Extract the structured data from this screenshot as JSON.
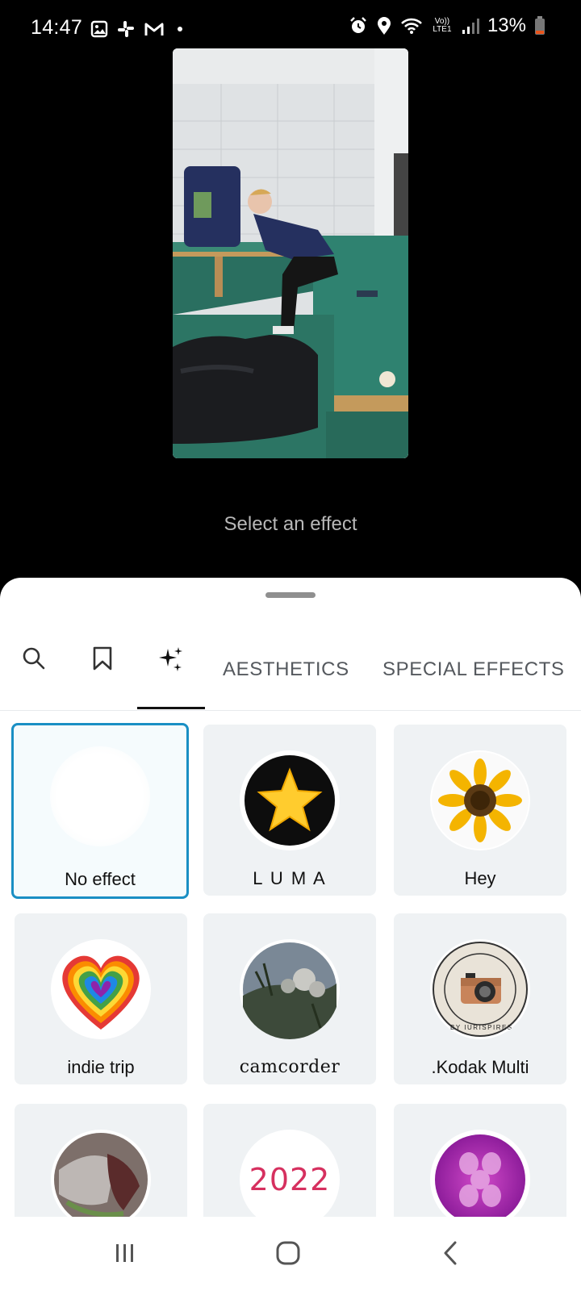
{
  "status_bar": {
    "time": "14:47",
    "network_label": "Vo)) LTE1",
    "battery": "13%"
  },
  "preview": {
    "hint": "Select an effect"
  },
  "tabs": {
    "search_icon": "search-icon",
    "saved_icon": "bookmark-icon",
    "featured_icon": "sparkles-icon",
    "aesthetics": "AESTHETICS",
    "special_effects": "SPECIAL EFFECTS"
  },
  "effects": [
    {
      "label": "No effect",
      "selected": true
    },
    {
      "label": "L U M A"
    },
    {
      "label": "Hey"
    },
    {
      "label": "indie trip"
    },
    {
      "label": "camcorder"
    },
    {
      "label": ".Kodak Multi"
    },
    {
      "label": ""
    },
    {
      "label": "",
      "thumb_text": "2022"
    },
    {
      "label": ""
    }
  ],
  "kodak_badge_text": ".BY IURISPIRES",
  "colors": {
    "accent_selected": "#1a8fc4",
    "sheet_bg": "#ffffff",
    "card_bg": "#eff2f4"
  }
}
